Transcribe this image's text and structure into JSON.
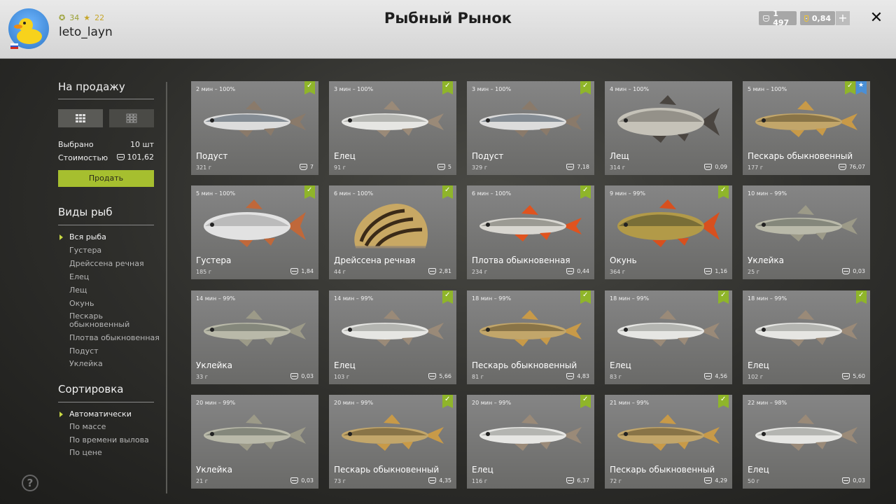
{
  "header": {
    "title": "Рыбный Рынок",
    "username": "leto_layn",
    "level": "34",
    "rank": "22",
    "silver": "1 497",
    "gold": "0,84",
    "plus": "+",
    "close": "✕"
  },
  "sidebar": {
    "sale_title": "На продажу",
    "selected_label": "Выбрано",
    "selected_value": "10 шт",
    "cost_label": "Стоимостью",
    "cost_value": "101,62",
    "sell_button": "Продать",
    "species_title": "Виды рыб",
    "species": [
      "Вся рыба",
      "Густера",
      "Дрейссена речная",
      "Елец",
      "Лещ",
      "Окунь",
      "Пескарь обыкновенный",
      "Плотва обыкновенная",
      "Подуст",
      "Уклейка"
    ],
    "sort_title": "Сортировка",
    "sort": [
      "Автоматически",
      "По массе",
      "По времени вылова",
      "По цене"
    ],
    "help": "?"
  },
  "colors": {
    "accent": "#a6bf2f",
    "badge_blue": "#4a8fd6"
  },
  "cards": [
    {
      "time": "2 мин – 100%",
      "name": "Подуст",
      "weight": "321 г",
      "price": "7",
      "fish": "podust",
      "badges": [
        "check"
      ]
    },
    {
      "time": "3 мин – 100%",
      "name": "Елец",
      "weight": "91 г",
      "price": "5",
      "fish": "elets",
      "badges": [
        "check"
      ]
    },
    {
      "time": "3 мин – 100%",
      "name": "Подуст",
      "weight": "329 г",
      "price": "7,18",
      "fish": "podust",
      "badges": [
        "check"
      ]
    },
    {
      "time": "4 мин – 100%",
      "name": "Лещ",
      "weight": "314 г",
      "price": "0,09",
      "fish": "leshch",
      "badges": []
    },
    {
      "time": "5 мин – 100%",
      "name": "Пескарь обыкновенный",
      "weight": "177 г",
      "price": "76,07",
      "fish": "peskar",
      "badges": [
        "check",
        "star"
      ]
    },
    {
      "time": "5 мин – 100%",
      "name": "Густера",
      "weight": "185 г",
      "price": "1,84",
      "fish": "gustera",
      "badges": [
        "check"
      ]
    },
    {
      "time": "6 мин – 100%",
      "name": "Дрейссена речная",
      "weight": "44 г",
      "price": "2,81",
      "fish": "mussel",
      "badges": [
        "check"
      ]
    },
    {
      "time": "6 мин – 100%",
      "name": "Плотва обыкновенная",
      "weight": "234 г",
      "price": "0,44",
      "fish": "plotva",
      "badges": [
        "check"
      ]
    },
    {
      "time": "9 мин – 99%",
      "name": "Окунь",
      "weight": "364 г",
      "price": "1,16",
      "fish": "okun",
      "badges": [
        "check"
      ]
    },
    {
      "time": "10 мин – 99%",
      "name": "Уклейка",
      "weight": "25 г",
      "price": "0,03",
      "fish": "ukleyka",
      "badges": []
    },
    {
      "time": "14 мин – 99%",
      "name": "Уклейка",
      "weight": "33 г",
      "price": "0,03",
      "fish": "ukleyka",
      "badges": []
    },
    {
      "time": "14 мин – 99%",
      "name": "Елец",
      "weight": "103 г",
      "price": "5,66",
      "fish": "elets",
      "badges": [
        "check"
      ]
    },
    {
      "time": "18 мин – 99%",
      "name": "Пескарь обыкновенный",
      "weight": "81 г",
      "price": "4,83",
      "fish": "peskar",
      "badges": [
        "check"
      ]
    },
    {
      "time": "18 мин – 99%",
      "name": "Елец",
      "weight": "83 г",
      "price": "4,56",
      "fish": "elets",
      "badges": [
        "check"
      ]
    },
    {
      "time": "18 мин – 99%",
      "name": "Елец",
      "weight": "102 г",
      "price": "5,60",
      "fish": "elets",
      "badges": [
        "check"
      ]
    },
    {
      "time": "20 мин – 99%",
      "name": "Уклейка",
      "weight": "21 г",
      "price": "0,03",
      "fish": "ukleyka",
      "badges": []
    },
    {
      "time": "20 мин – 99%",
      "name": "Пескарь обыкновенный",
      "weight": "73 г",
      "price": "4,35",
      "fish": "peskar",
      "badges": [
        "check"
      ]
    },
    {
      "time": "20 мин – 99%",
      "name": "Елец",
      "weight": "116 г",
      "price": "6,37",
      "fish": "elets",
      "badges": [
        "check"
      ]
    },
    {
      "time": "21 мин – 99%",
      "name": "Пескарь обыкновенный",
      "weight": "72 г",
      "price": "4,29",
      "fish": "peskar",
      "badges": [
        "check"
      ]
    },
    {
      "time": "22 мин – 98%",
      "name": "Елец",
      "weight": "50 г",
      "price": "0,03",
      "fish": "elets",
      "badges": []
    }
  ]
}
